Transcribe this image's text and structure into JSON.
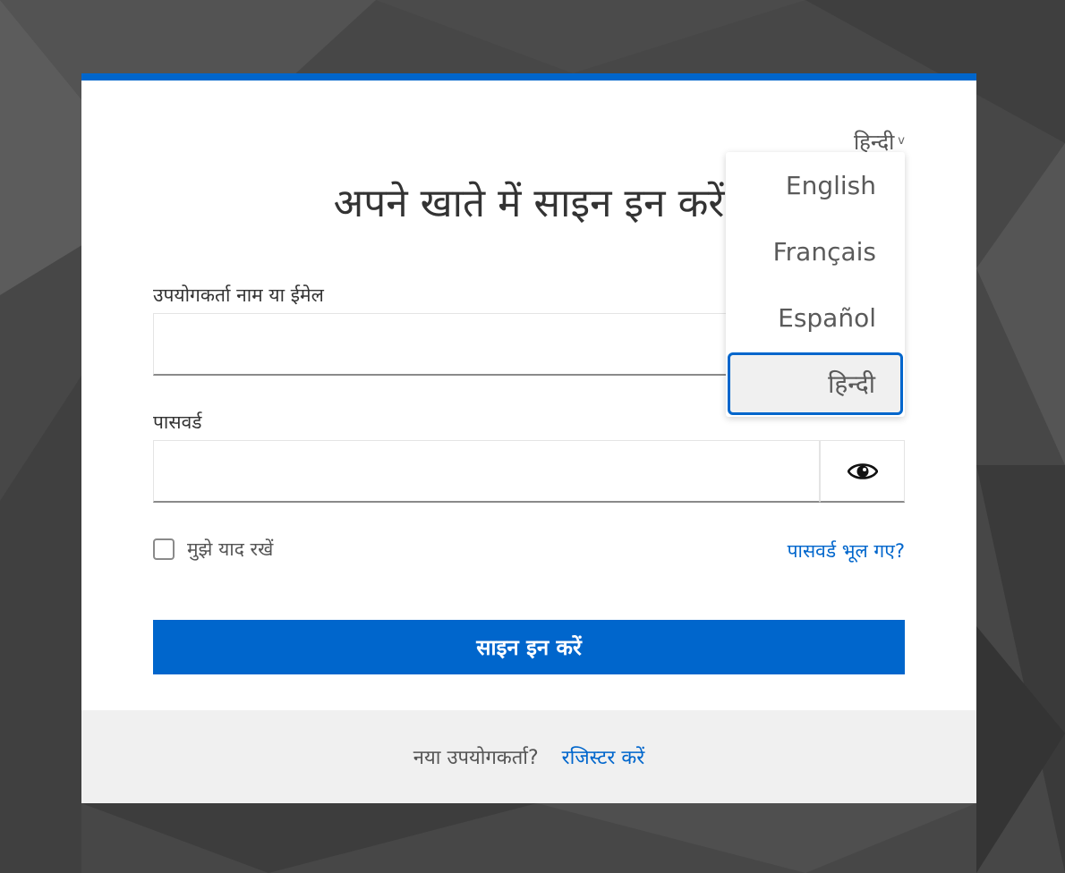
{
  "language": {
    "current": "हिन्दी",
    "caret": "v",
    "options": [
      "English",
      "Français",
      "Español",
      "हिन्दी"
    ],
    "selected": "हिन्दी"
  },
  "form": {
    "title": "अपने खाते में साइन इन करें",
    "username_label": "उपयोगकर्ता नाम या ईमेल",
    "username_value": "",
    "password_label": "पासवर्ड",
    "password_value": "",
    "remember_label": "मुझे याद रखें",
    "remember_checked": false,
    "forgot_link": "पासवर्ड भूल गए?",
    "submit_label": "साइन इन करें"
  },
  "footer": {
    "new_user_text": "नया उपयोगकर्ता?",
    "register_link": "रजिस्टर करें"
  },
  "colors": {
    "accent": "#0066cc",
    "background": "#474747",
    "footer_bg": "#f0f0f0"
  },
  "icons": {
    "password_toggle": "eye-icon",
    "language_caret": "chevron-down-icon"
  }
}
